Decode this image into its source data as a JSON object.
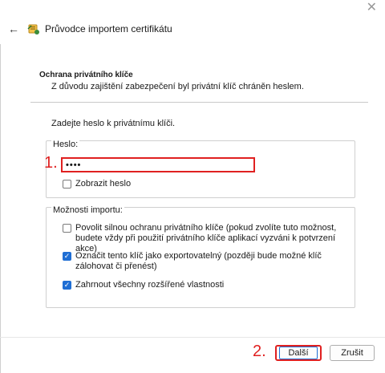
{
  "window": {
    "title": "Průvodce importem certifikátu",
    "close_glyph": "✕",
    "back_glyph": "←"
  },
  "page": {
    "heading": "Ochrana privátního klíče",
    "subheading": "Z důvodu zajištění zabezpečení byl privátní klíč chráněn heslem.",
    "prompt": "Zadejte heslo k privátnímu klíči."
  },
  "password_group": {
    "title": "Heslo:",
    "value": "••••",
    "show_password_label": "Zobrazit heslo",
    "show_password_checked": false
  },
  "options_group": {
    "title": "Možnosti importu:",
    "items": [
      {
        "label": "Povolit silnou ochranu privátního klíče (pokud zvolíte tuto možnost, budete vždy při použití privátního klíče aplikací vyzváni k potvrzení akce)",
        "checked": false
      },
      {
        "label": "Označit tento klíč jako exportovatelný (později bude možné klíč zálohovat či přenést)",
        "checked": true
      },
      {
        "label": "Zahrnout všechny rozšířené vlastnosti",
        "checked": true
      }
    ]
  },
  "annotations": {
    "step1": "1.",
    "step2": "2."
  },
  "buttons": {
    "next": "Další",
    "cancel": "Zrušit"
  },
  "colors": {
    "accent": "#1f6ed4",
    "annotation": "#e02020"
  },
  "icons": {
    "back": "arrow-left-icon",
    "wizard": "certificate-wizard-icon",
    "close": "close-icon"
  }
}
